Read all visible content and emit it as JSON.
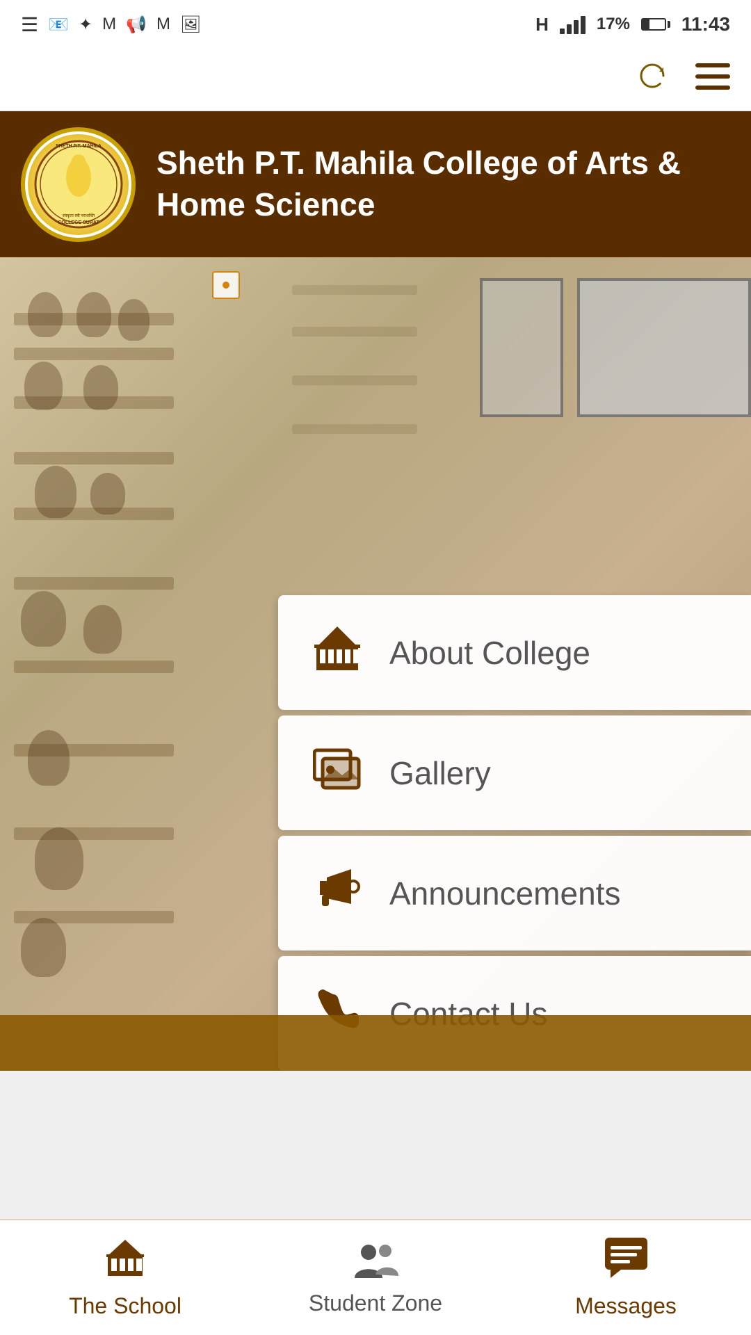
{
  "statusBar": {
    "battery": "17%",
    "time": "11:43",
    "networkLabel": "H"
  },
  "header": {
    "collegeName": "Sheth P.T. Mahila College of Arts & Home Science",
    "logoText": "SHETH P.T. MAHILA COLLEGE SURAT"
  },
  "toolbar": {
    "refreshLabel": "refresh",
    "menuLabel": "menu"
  },
  "menuItems": [
    {
      "id": "about-college",
      "label": "About College",
      "icon": "bank"
    },
    {
      "id": "gallery",
      "label": "Gallery",
      "icon": "images"
    },
    {
      "id": "announcements",
      "label": "Announcements",
      "icon": "megaphone"
    },
    {
      "id": "contact-us",
      "label": "Contact Us",
      "icon": "phone"
    }
  ],
  "bottomNav": [
    {
      "id": "the-school",
      "label": "The School",
      "icon": "school"
    },
    {
      "id": "student-zone",
      "label": "Student Zone",
      "icon": "students"
    },
    {
      "id": "messages",
      "label": "Messages",
      "icon": "messages"
    }
  ]
}
